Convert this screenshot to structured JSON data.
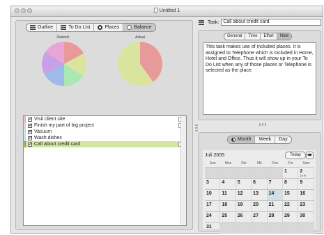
{
  "window": {
    "title": "Untitled 1"
  },
  "view_tabs": [
    {
      "label": "Outline",
      "icon": "outline-icon",
      "selected": false
    },
    {
      "label": "To Do List",
      "icon": "todo-list-icon",
      "selected": false
    },
    {
      "label": "Places",
      "icon": "places-radio-icon",
      "selected": false
    },
    {
      "label": "Balance",
      "icon": "balance-icon",
      "selected": true
    }
  ],
  "charts": {
    "desired_label": "Desired",
    "actual_label": "Actual"
  },
  "chart_data": [
    {
      "type": "pie",
      "title": "Desired",
      "categories": [
        "",
        "",
        "",
        "",
        "",
        ""
      ],
      "values": [
        17,
        17,
        16,
        17,
        17,
        16
      ],
      "colors": [
        "#e89a9a",
        "#d9e49e",
        "#a9e7b4",
        "#9dbbe6",
        "#c9a0e8",
        "#e8a5d6"
      ]
    },
    {
      "type": "pie",
      "title": "Actual",
      "categories": [
        "",
        ""
      ],
      "values": [
        40,
        60
      ],
      "colors": [
        "#e89a9a",
        "#d9e49e"
      ]
    }
  ],
  "todo_list": {
    "items": [
      {
        "label": "Visit client site",
        "checked": true,
        "color": "#e6a0c0",
        "selected": false
      },
      {
        "label": "Finish my part of big project",
        "checked": true,
        "color": "#d8c4e6",
        "selected": false
      },
      {
        "label": "Vacuum",
        "checked": true,
        "color": "#b9d4ee",
        "selected": false
      },
      {
        "label": "Wash dishes",
        "checked": true,
        "color": "#b9d4ee",
        "selected": false
      },
      {
        "label": "Call about credit card",
        "checked": true,
        "color": "#6fae3a",
        "selected": true
      }
    ]
  },
  "task": {
    "label": "Task:",
    "value": "Call about credit card"
  },
  "detail_tabs": [
    {
      "label": "General",
      "selected": false
    },
    {
      "label": "Time",
      "selected": false
    },
    {
      "label": "Effort",
      "selected": false
    },
    {
      "label": "Note",
      "selected": true
    }
  ],
  "note": {
    "text": "This task makes use of included places.  It is assigned to Telephone which is included in Home, Hotel and Office.  Thus it will show up in your To Do List when any of those places or Telephone is selected as the place."
  },
  "calendar": {
    "views": [
      {
        "label": "Month",
        "selected": true
      },
      {
        "label": "Week",
        "selected": false
      },
      {
        "label": "Day",
        "selected": false
      }
    ],
    "month_label": "Juli 2005",
    "today_label": "Today",
    "weekdays": [
      "Son",
      "Mon",
      "Die",
      "Mit",
      "Don",
      "Fre",
      "Sam"
    ],
    "weeks": [
      [
        "",
        "",
        "",
        "",
        "",
        "1",
        "2"
      ],
      [
        "3",
        "4",
        "5",
        "6",
        "7",
        "8",
        "9"
      ],
      [
        "10",
        "11",
        "12",
        "13",
        "14",
        "15",
        "16"
      ],
      [
        "17",
        "18",
        "19",
        "20",
        "21",
        "22",
        "23"
      ],
      [
        "24",
        "25",
        "26",
        "27",
        "28",
        "29",
        "30"
      ],
      [
        "31",
        "",
        "",
        "",
        "",
        "",
        ""
      ]
    ],
    "highlight_day": "14",
    "event": {
      "day": "2",
      "label": "19 H"
    }
  }
}
